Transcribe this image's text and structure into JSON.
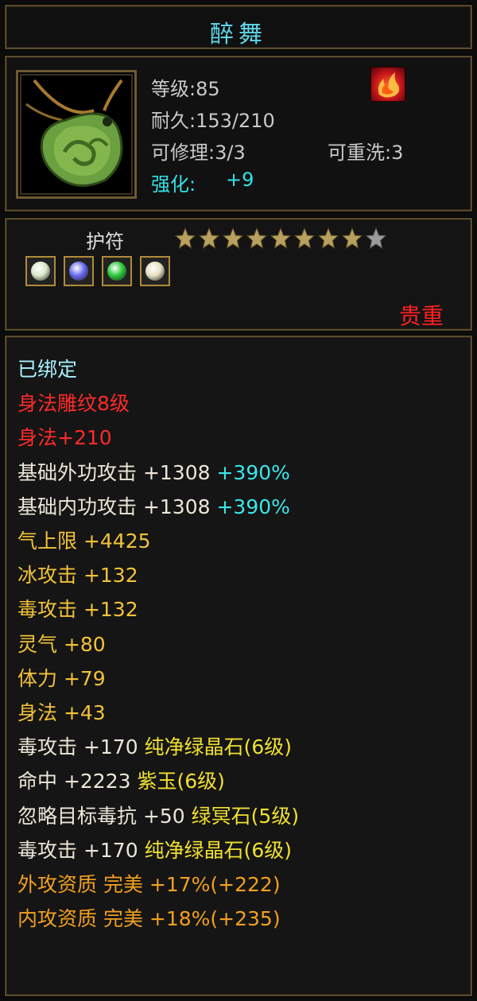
{
  "item": {
    "name": "醉舞",
    "level": "等级:85",
    "durability": "耐久:153/210",
    "repairable": "可修理:3/3",
    "rewashable": "可重洗:3",
    "enhance_label": "强化:",
    "enhance_value": "+9",
    "icon": "jade-pendant-icon",
    "school_icon": "flame-school-icon"
  },
  "type": {
    "label": "护符",
    "stars_total": 9,
    "stars_filled": 8,
    "rarity": "贵重",
    "gems": [
      {
        "name": "white-gem-icon",
        "color": "#d8e8c8"
      },
      {
        "name": "purple-gem-icon",
        "color": "#6a6af0"
      },
      {
        "name": "green-gem-icon",
        "color": "#2cc83a"
      },
      {
        "name": "white-gem-icon",
        "color": "#e6e0c0"
      }
    ]
  },
  "attributes": [
    {
      "parts": [
        {
          "t": "已绑定",
          "c": "c-cyan"
        }
      ]
    },
    {
      "parts": [
        {
          "t": "身法雕纹8级",
          "c": "c-red"
        }
      ]
    },
    {
      "parts": [
        {
          "t": "身法+210",
          "c": "c-red"
        }
      ]
    },
    {
      "parts": [
        {
          "t": "基础外功攻击 +1308 ",
          "c": "c-white"
        },
        {
          "t": "+390%",
          "c": "c-cy2"
        }
      ]
    },
    {
      "parts": [
        {
          "t": "基础内功攻击 +1308 ",
          "c": "c-white"
        },
        {
          "t": "+390%",
          "c": "c-cy2"
        }
      ]
    },
    {
      "parts": [
        {
          "t": "气上限 +4425",
          "c": "c-gold"
        }
      ]
    },
    {
      "parts": [
        {
          "t": "冰攻击 +132",
          "c": "c-gold"
        }
      ]
    },
    {
      "parts": [
        {
          "t": "毒攻击 +132",
          "c": "c-gold"
        }
      ]
    },
    {
      "parts": [
        {
          "t": "灵气 +80",
          "c": "c-gold"
        }
      ]
    },
    {
      "parts": [
        {
          "t": "体力 +79",
          "c": "c-gold"
        }
      ]
    },
    {
      "parts": [
        {
          "t": "身法 +43",
          "c": "c-gold"
        }
      ]
    },
    {
      "parts": [
        {
          "t": "毒攻击 +170 ",
          "c": "c-white"
        },
        {
          "t": "纯净绿晶石(6级)",
          "c": "c-grn"
        }
      ]
    },
    {
      "parts": [
        {
          "t": "命中 +2223 ",
          "c": "c-white"
        },
        {
          "t": "紫玉(6级)",
          "c": "c-grn"
        }
      ]
    },
    {
      "parts": [
        {
          "t": "忽略目标毒抗 +50 ",
          "c": "c-white"
        },
        {
          "t": "绿冥石(5级)",
          "c": "c-grn"
        }
      ]
    },
    {
      "parts": [
        {
          "t": "毒攻击 +170 ",
          "c": "c-white"
        },
        {
          "t": "纯净绿晶石(6级)",
          "c": "c-grn"
        }
      ]
    },
    {
      "parts": [
        {
          "t": "外攻资质  完美 +17%(+222)",
          "c": "c-org"
        }
      ]
    },
    {
      "parts": [
        {
          "t": "内攻资质  完美 +18%(+235)",
          "c": "c-org"
        }
      ]
    }
  ]
}
